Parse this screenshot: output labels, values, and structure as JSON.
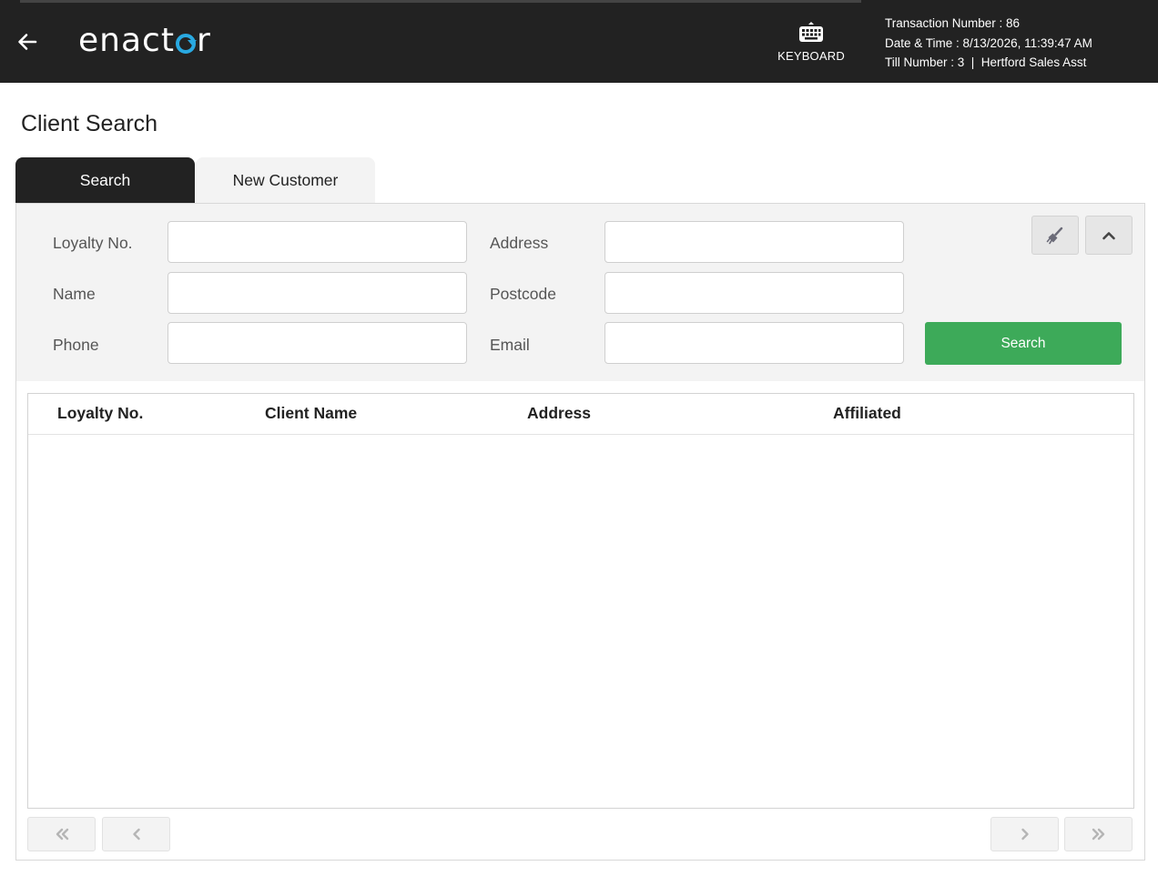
{
  "header": {
    "back_icon": "arrow-left-icon",
    "logo_text_left": "enact",
    "logo_text_right": "r",
    "keyboard_icon": "keyboard-icon",
    "keyboard_label": "KEYBOARD",
    "transaction_number": "Transaction Number : 86",
    "date_time": "Date & Time : 8/13/2026, 11:39:47 AM",
    "till_info": "Till Number : 3  |  Hertford Sales Asst"
  },
  "page": {
    "title": "Client Search"
  },
  "tabs": [
    {
      "label": "Search",
      "active": true
    },
    {
      "label": "New Customer",
      "active": false
    }
  ],
  "search_form": {
    "loyalty_label": "Loyalty No.",
    "loyalty_value": "",
    "name_label": "Name",
    "name_value": "",
    "phone_label": "Phone",
    "phone_value": "",
    "address_label": "Address",
    "address_value": "",
    "postcode_label": "Postcode",
    "postcode_value": "",
    "email_label": "Email",
    "email_value": "",
    "clear_icon": "broom-icon",
    "collapse_icon": "chevron-up-icon",
    "search_button": "Search"
  },
  "results": {
    "columns": [
      "Loyalty No.",
      "Client Name",
      "Address",
      "Affiliated"
    ],
    "rows": []
  },
  "pagination": {
    "first_icon": "double-chevron-left-icon",
    "prev_icon": "chevron-left-icon",
    "next_icon": "chevron-right-icon",
    "last_icon": "double-chevron-right-icon"
  },
  "colors": {
    "header_bg": "#222222",
    "accent_blue": "#29a9e1",
    "search_green": "#3daa59",
    "panel_bg": "#f3f3f3"
  }
}
